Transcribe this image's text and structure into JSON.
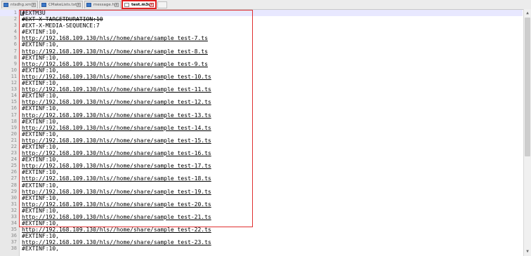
{
  "tabs": [
    {
      "label": "ntsdhg.xml",
      "active": false
    },
    {
      "label": "CMakeLists.txt",
      "active": false
    },
    {
      "label": "message.h",
      "active": false
    },
    {
      "label": "test.m3u8",
      "active": true
    }
  ],
  "editor": {
    "lines": [
      {
        "num": "1",
        "text": "#EXTM3U"
      },
      {
        "num": "2",
        "text": "#EXT-X-TARGETDURATION:10"
      },
      {
        "num": "3",
        "text": "#EXT-X-MEDIA-SEQUENCE:7"
      },
      {
        "num": "4",
        "text": "#EXTINF:10,"
      },
      {
        "num": "5",
        "text": "http://192.168.109.130/hls//home/share/sample_test-7.ts"
      },
      {
        "num": "6",
        "text": "#EXTINF:10,"
      },
      {
        "num": "7",
        "text": "http://192.168.109.130/hls//home/share/sample_test-8.ts"
      },
      {
        "num": "8",
        "text": "#EXTINF:10,"
      },
      {
        "num": "9",
        "text": "http://192.168.109.130/hls//home/share/sample_test-9.ts"
      },
      {
        "num": "10",
        "text": "#EXTINF:10,"
      },
      {
        "num": "11",
        "text": "http://192.168.109.130/hls//home/share/sample_test-10.ts"
      },
      {
        "num": "12",
        "text": "#EXTINF:10,"
      },
      {
        "num": "13",
        "text": "http://192.168.109.130/hls//home/share/sample_test-11.ts"
      },
      {
        "num": "14",
        "text": "#EXTINF:10,"
      },
      {
        "num": "15",
        "text": "http://192.168.109.130/hls//home/share/sample_test-12.ts"
      },
      {
        "num": "16",
        "text": "#EXTINF:10,"
      },
      {
        "num": "17",
        "text": "http://192.168.109.130/hls//home/share/sample_test-13.ts"
      },
      {
        "num": "18",
        "text": "#EXTINF:10,"
      },
      {
        "num": "19",
        "text": "http://192.168.109.130/hls//home/share/sample_test-14.ts"
      },
      {
        "num": "20",
        "text": "#EXTINF:10,"
      },
      {
        "num": "21",
        "text": "http://192.168.109.130/hls//home/share/sample_test-15.ts"
      },
      {
        "num": "22",
        "text": "#EXTINF:10,"
      },
      {
        "num": "23",
        "text": "http://192.168.109.130/hls//home/share/sample_test-16.ts"
      },
      {
        "num": "24",
        "text": "#EXTINF:10,"
      },
      {
        "num": "25",
        "text": "http://192.168.109.130/hls//home/share/sample_test-17.ts"
      },
      {
        "num": "26",
        "text": "#EXTINF:10,"
      },
      {
        "num": "27",
        "text": "http://192.168.109.130/hls//home/share/sample_test-18.ts"
      },
      {
        "num": "28",
        "text": "#EXTINF:10,"
      },
      {
        "num": "29",
        "text": "http://192.168.109.130/hls//home/share/sample_test-19.ts"
      },
      {
        "num": "30",
        "text": "#EXTINF:10,"
      },
      {
        "num": "31",
        "text": "http://192.168.109.130/hls//home/share/sample_test-20.ts"
      },
      {
        "num": "32",
        "text": "#EXTINF:10,"
      },
      {
        "num": "33",
        "text": "http://192.168.109.130/hls//home/share/sample_test-21.ts"
      },
      {
        "num": "34",
        "text": "#EXTINF:10,"
      },
      {
        "num": "35",
        "text": "http://192.168.109.130/hls//home/share/sample_test-22.ts"
      },
      {
        "num": "36",
        "text": "#EXTINF:10,"
      },
      {
        "num": "37",
        "text": "http://192.168.109.130/hls//home/share/sample_test-23.ts"
      },
      {
        "num": "38",
        "text": "#EXTINF:10,"
      }
    ]
  },
  "scrollbar": {
    "up_icon": "arrow-up-icon",
    "down_icon": "arrow-down-icon",
    "up_glyph": "▲",
    "down_glyph": "▼",
    "thumb_position": 0.0
  },
  "colors": {
    "highlight_box": "#e03030",
    "active_tab_border": "#e02020"
  }
}
